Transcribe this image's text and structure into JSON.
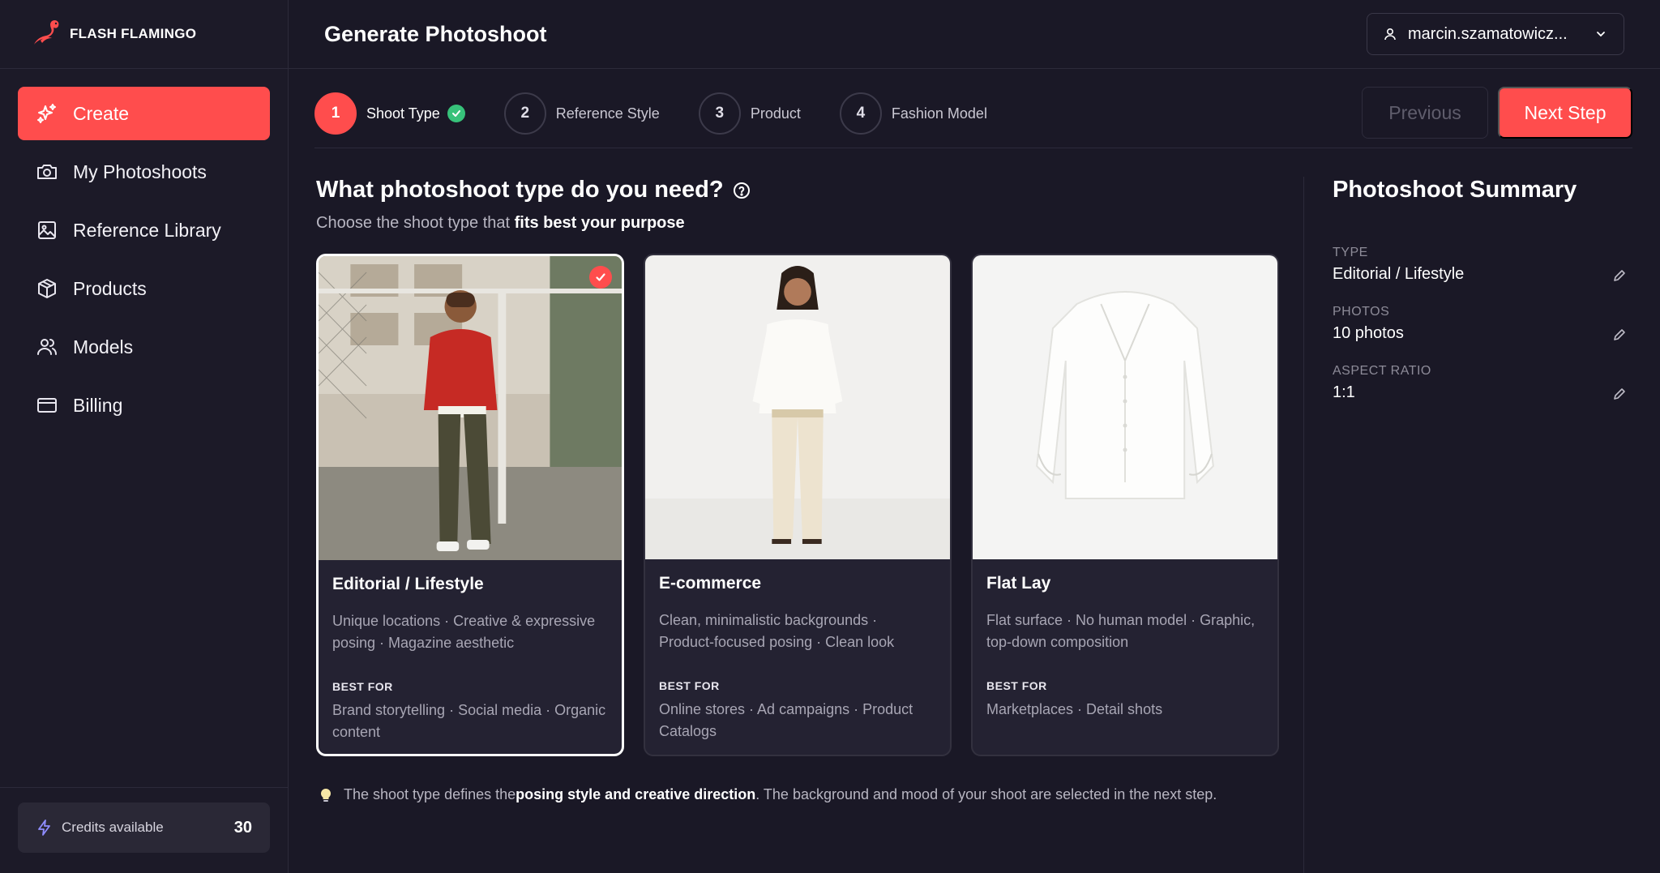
{
  "brand": {
    "name": "FLASH FLAMINGO",
    "accent": "#ff4d4d"
  },
  "header": {
    "title": "Generate Photoshoot",
    "user": "marcin.szamatowicz..."
  },
  "sidebar": {
    "items": [
      {
        "label": "Create",
        "icon": "sparkles-icon",
        "active": true
      },
      {
        "label": "My Photoshoots",
        "icon": "camera-icon"
      },
      {
        "label": "Reference Library",
        "icon": "image-icon"
      },
      {
        "label": "Products",
        "icon": "box-icon"
      },
      {
        "label": "Models",
        "icon": "users-icon"
      },
      {
        "label": "Billing",
        "icon": "credit-card-icon"
      }
    ],
    "credits": {
      "label": "Credits available",
      "count": "30"
    }
  },
  "stepper": {
    "steps": [
      {
        "num": "1",
        "label": "Shoot Type",
        "done": true
      },
      {
        "num": "2",
        "label": "Reference Style"
      },
      {
        "num": "3",
        "label": "Product"
      },
      {
        "num": "4",
        "label": "Fashion Model"
      }
    ],
    "prev_label": "Previous",
    "next_label": "Next Step"
  },
  "main": {
    "title": "What photoshoot type do you need?",
    "subtitle_pre": "Choose the shoot type that ",
    "subtitle_bold": "fits best your purpose",
    "best_for_label": "BEST FOR",
    "cards": [
      {
        "title": "Editorial / Lifestyle",
        "desc": "Unique locations · Creative & expressive posing · Magazine aesthetic",
        "best": "Brand storytelling · Social media · Organic content",
        "selected": true
      },
      {
        "title": "E-commerce",
        "desc": "Clean, minimalistic backgrounds · Product-focused posing · Clean look",
        "best": "Online stores · Ad campaigns · Product Catalogs"
      },
      {
        "title": "Flat Lay",
        "desc": "Flat surface · No human model · Graphic, top-down composition",
        "best": "Marketplaces · Detail shots"
      }
    ],
    "tip_pre": "The shoot type defines the ",
    "tip_bold": "posing style and creative direction",
    "tip_post": ". The background and mood of your shoot are selected in the next step."
  },
  "summary": {
    "title": "Photoshoot Summary",
    "rows": [
      {
        "label": "TYPE",
        "value": "Editorial / Lifestyle"
      },
      {
        "label": "PHOTOS",
        "value": "10 photos"
      },
      {
        "label": "ASPECT RATIO",
        "value": "1:1"
      }
    ]
  }
}
